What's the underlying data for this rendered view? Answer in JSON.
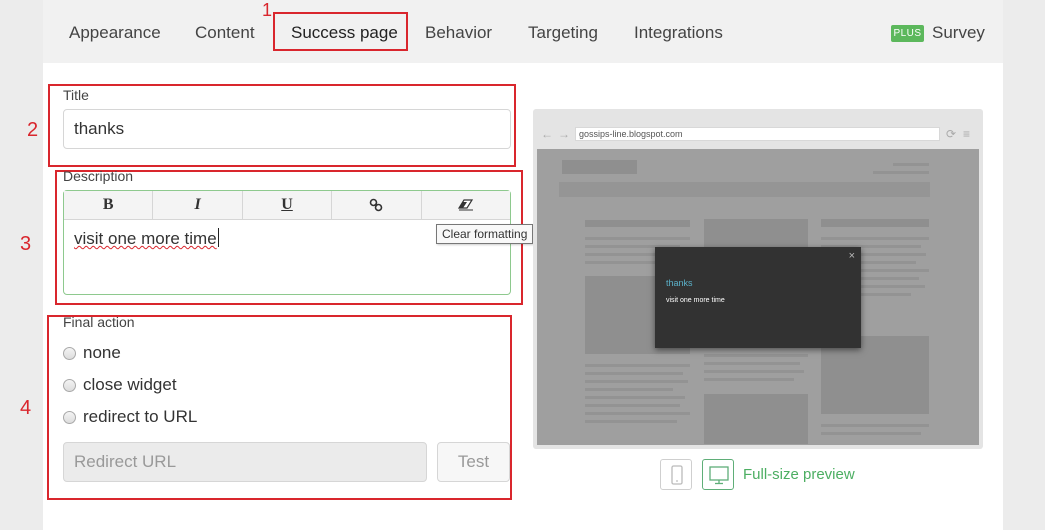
{
  "tabs": [
    {
      "label": "Appearance"
    },
    {
      "label": "Content"
    },
    {
      "label": "Success page"
    },
    {
      "label": "Behavior"
    },
    {
      "label": "Targeting"
    },
    {
      "label": "Integrations"
    }
  ],
  "plus_badge": "PLUS",
  "survey_tab": "Survey",
  "annotations": [
    "1",
    "2",
    "3",
    "4"
  ],
  "title_field": {
    "label": "Title",
    "value": "thanks"
  },
  "description": {
    "label": "Description",
    "toolbar": [
      {
        "label": "B",
        "icon": "bold-icon"
      },
      {
        "label": "I",
        "icon": "italic-icon"
      },
      {
        "label": "U",
        "icon": "underline-icon"
      },
      {
        "label": "",
        "icon": "link-icon"
      },
      {
        "label": "",
        "icon": "eraser-icon"
      }
    ],
    "text": "visit one more time",
    "tooltip": "Clear formatting"
  },
  "final_action": {
    "label": "Final action",
    "options": [
      "none",
      "close widget",
      "redirect to URL"
    ],
    "url_placeholder": "Redirect URL",
    "test_label": "Test"
  },
  "preview": {
    "url": "gossips-line.blogspot.com",
    "popup_title": "thanks",
    "popup_desc": "visit one more time",
    "close_glyph": "×",
    "fullsize_label": "Full-size preview"
  },
  "colors": {
    "annotation": "#d9262d",
    "accent_green": "#5cb85c",
    "popup_title": "#5bb0c8"
  }
}
